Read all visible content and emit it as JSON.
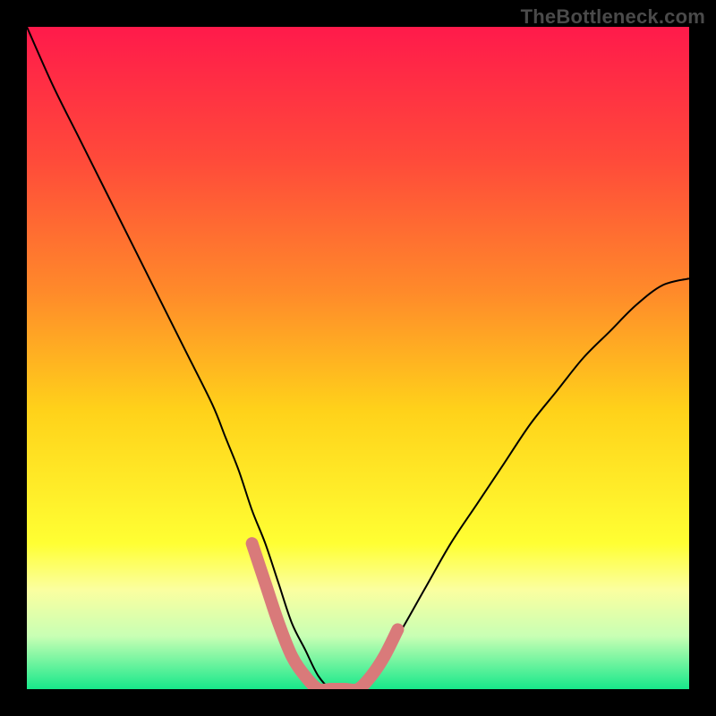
{
  "watermark": "TheBottleneck.com",
  "chart_data": {
    "type": "line",
    "title": "",
    "xlabel": "",
    "ylabel": "",
    "xlim": [
      0,
      100
    ],
    "ylim": [
      0,
      100
    ],
    "grid": false,
    "legend": false,
    "background": {
      "kind": "vertical-gradient",
      "stops": [
        {
          "pos": 0.0,
          "color": "#ff1a4b"
        },
        {
          "pos": 0.2,
          "color": "#ff4a3a"
        },
        {
          "pos": 0.4,
          "color": "#ff8a2a"
        },
        {
          "pos": 0.58,
          "color": "#ffd21a"
        },
        {
          "pos": 0.78,
          "color": "#ffff33"
        },
        {
          "pos": 0.85,
          "color": "#fbffa0"
        },
        {
          "pos": 0.92,
          "color": "#c8ffb4"
        },
        {
          "pos": 1.0,
          "color": "#17e88a"
        }
      ]
    },
    "series": [
      {
        "name": "profile-curve",
        "stroke": "#000000",
        "stroke_width": 2,
        "x": [
          0,
          4,
          8,
          12,
          16,
          20,
          24,
          28,
          30,
          32,
          34,
          36,
          38,
          40,
          42,
          44,
          46,
          48,
          50,
          52,
          56,
          60,
          64,
          68,
          72,
          76,
          80,
          84,
          88,
          92,
          96,
          100
        ],
        "y": [
          100,
          91,
          83,
          75,
          67,
          59,
          51,
          43,
          38,
          33,
          27,
          22,
          16,
          10,
          6,
          2,
          0,
          0,
          0,
          2,
          8,
          15,
          22,
          28,
          34,
          40,
          45,
          50,
          54,
          58,
          61,
          62
        ]
      },
      {
        "name": "bottom-marker",
        "stroke": "#d97a7a",
        "stroke_width": 14,
        "linecap": "round",
        "x": [
          34,
          36,
          38,
          40,
          42,
          44,
          46,
          48,
          50,
          52,
          54,
          56
        ],
        "y": [
          22,
          16,
          10,
          5,
          2,
          0,
          0,
          0,
          0,
          2,
          5,
          9
        ]
      }
    ]
  }
}
